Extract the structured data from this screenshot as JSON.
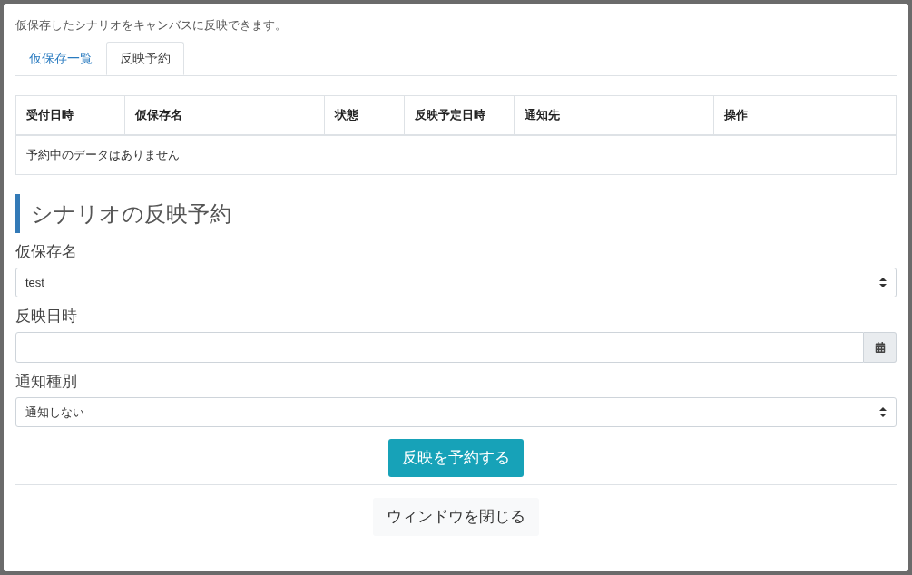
{
  "intro": "仮保存したシナリオをキャンバスに反映できます。",
  "tabs": [
    {
      "label": "仮保存一覧",
      "selected": false
    },
    {
      "label": "反映予約",
      "selected": true
    }
  ],
  "table": {
    "columns": [
      "受付日時",
      "仮保存名",
      "状態",
      "反映予定日時",
      "通知先",
      "操作"
    ],
    "empty_message": "予約中のデータはありません"
  },
  "section_title": "シナリオの反映予約",
  "fields": [
    {
      "kind": "select",
      "label": "仮保存名",
      "value": "test"
    },
    {
      "kind": "date",
      "label": "反映日時"
    },
    {
      "kind": "select",
      "label": "通知種別",
      "value": "通知しない"
    }
  ],
  "submit_button": "反映を予約する",
  "close_button": "ウィンドウを閉じる"
}
